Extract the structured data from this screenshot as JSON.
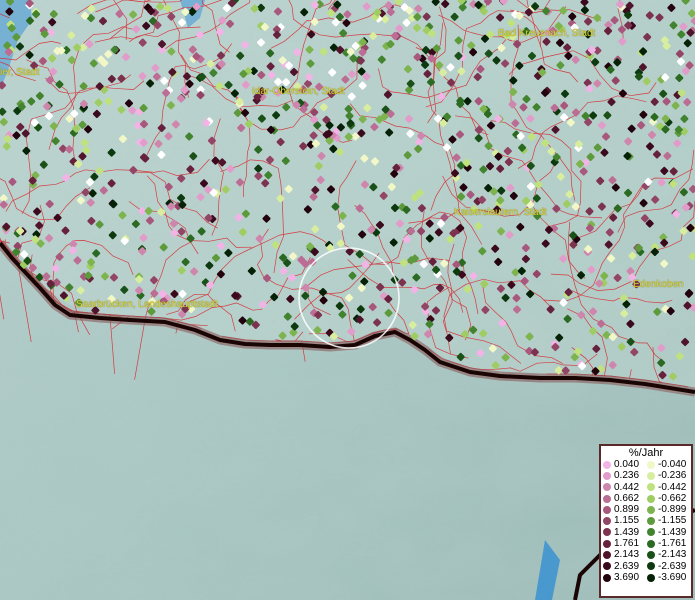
{
  "cities": [
    {
      "name": "Bad Kreuznach, Stadt"
    },
    {
      "name": "Idar-Oberstein, Stadt"
    },
    {
      "name": "Kaiserslautern, Stadt"
    },
    {
      "name": "Saarbrücken, Landeshauptstadt"
    },
    {
      "name": "Edenkoben"
    },
    {
      "name": "ier, Stadt"
    }
  ],
  "legend": {
    "title": "%/Jahr",
    "positive": [
      {
        "label": "0.040",
        "color": "#f2b3e6"
      },
      {
        "label": "0.236",
        "color": "#e29cc9"
      },
      {
        "label": "0.442",
        "color": "#cf86ad"
      },
      {
        "label": "0.662",
        "color": "#bc6d93"
      },
      {
        "label": "0.899",
        "color": "#a8587c"
      },
      {
        "label": "1.155",
        "color": "#934565"
      },
      {
        "label": "1.439",
        "color": "#7c334f"
      },
      {
        "label": "1.761",
        "color": "#66223c"
      },
      {
        "label": "2.143",
        "color": "#4f142b"
      },
      {
        "label": "2.639",
        "color": "#3a0a1c"
      },
      {
        "label": "3.690",
        "color": "#22020c"
      }
    ],
    "negative": [
      {
        "label": "-0.040",
        "color": "#f1f7c7"
      },
      {
        "label": "-0.236",
        "color": "#d8ee9e"
      },
      {
        "label": "-0.442",
        "color": "#bfe27e"
      },
      {
        "label": "-0.662",
        "color": "#9fcd63"
      },
      {
        "label": "-0.899",
        "color": "#7eb44f"
      },
      {
        "label": "-1.155",
        "color": "#5c9a3c"
      },
      {
        "label": "-1.439",
        "color": "#42832f"
      },
      {
        "label": "-1.761",
        "color": "#2b6a22"
      },
      {
        "label": "-2.143",
        "color": "#1a5118"
      },
      {
        "label": "-2.639",
        "color": "#0d390e"
      },
      {
        "label": "-3.690",
        "color": "#052106"
      }
    ]
  },
  "colors": {
    "terrain": "#9cc0bc",
    "terrain_shade": "#7aa3a0",
    "boundary": "#d8232a",
    "border": "#2a0a0a",
    "water": "#3f94cf",
    "city_label": "#d8d23a",
    "highlight_circle": "#ffffff"
  }
}
